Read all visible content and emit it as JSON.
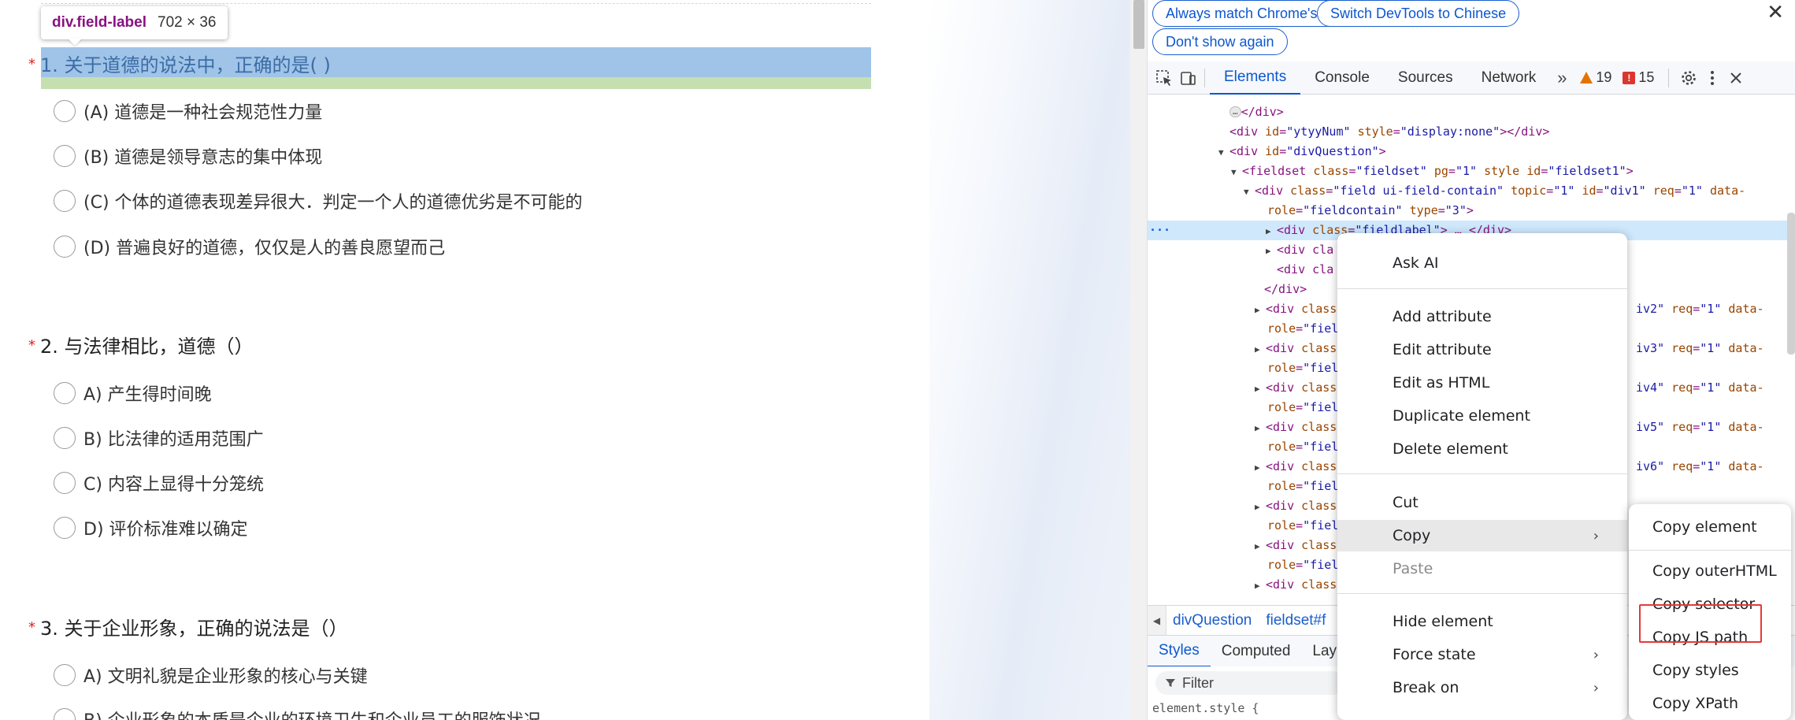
{
  "inspect_tooltip": {
    "tag": "div",
    "class": ".field-label",
    "size": "702 × 36"
  },
  "questions": [
    {
      "number": "1.",
      "title": "关于道德的说法中，正确的是( )",
      "options": [
        "(A) 道德是一种社会规范性力量",
        "(B) 道德是领导意志的集中体现",
        "(C) 个体的道德表现差异很大．判定一个人的道德优劣是不可能的",
        "(D) 普遍良好的道德，仅仅是人的善良愿望而己"
      ]
    },
    {
      "number": "2.",
      "title": "与法律相比，道德（）",
      "options": [
        "A) 产生得时间晚",
        "B) 比法律的适用范围广",
        "C) 内容上显得十分笼统",
        "D) 评价标准难以确定"
      ]
    },
    {
      "number": "3.",
      "title": "关于企业形象，正确的说法是（）",
      "options": [
        "A) 文明礼貌是企业形象的核心与关键",
        "B) 企业形象的本质是企业的环境卫生和企业员工的服饰状况"
      ]
    }
  ],
  "required_mark": "*",
  "devtools": {
    "lang_bar": {
      "match_language": "Always match Chrome's language",
      "switch_language": "Switch DevTools to Chinese",
      "dont_show": "Don't show again",
      "close": "✕"
    },
    "tabs": [
      "Elements",
      "Console",
      "Sources",
      "Network"
    ],
    "more_tabs": "»",
    "warnings": "19",
    "errors": "15",
    "dom_lines": [
      {
        "indent": 0,
        "html": ""
      },
      {
        "indent": 1,
        "tag": "</div>"
      },
      {
        "indent": 1,
        "text": "<div id=\"ytyyNum\" style=\"display:none\"></div>"
      },
      {
        "indent": 1,
        "text": "▼<div id=\"divQuestion\">"
      },
      {
        "indent": 2,
        "text": "▼<fieldset class=\"fieldset\" pg=\"1\" style id=\"fieldset1\">"
      },
      {
        "indent": 3,
        "text": "▼<div class=\"field ui-field-contain\" topic=\"1\" id=\"div1\" req=\"1\" data-"
      },
      {
        "indent": 4,
        "text": "role=\"fieldcontain\" type=\"3\">"
      }
    ],
    "breadcrumbs": [
      "divQuestion",
      "fieldset#f"
    ],
    "sub_tabs": [
      "Styles",
      "Computed",
      "Lay"
    ],
    "filter_placeholder": "Filter",
    "element_style": "element.style {"
  },
  "context_menu": {
    "items": [
      "Ask AI",
      "Add attribute",
      "Edit attribute",
      "Edit as HTML",
      "Duplicate element",
      "Delete element",
      "Cut",
      "Copy",
      "Paste",
      "Hide element",
      "Force state",
      "Break on"
    ]
  },
  "copy_submenu": {
    "items": [
      "Copy element",
      "Copy outerHTML",
      "Copy selector",
      "Copy JS path",
      "Copy styles",
      "Copy XPath"
    ]
  }
}
